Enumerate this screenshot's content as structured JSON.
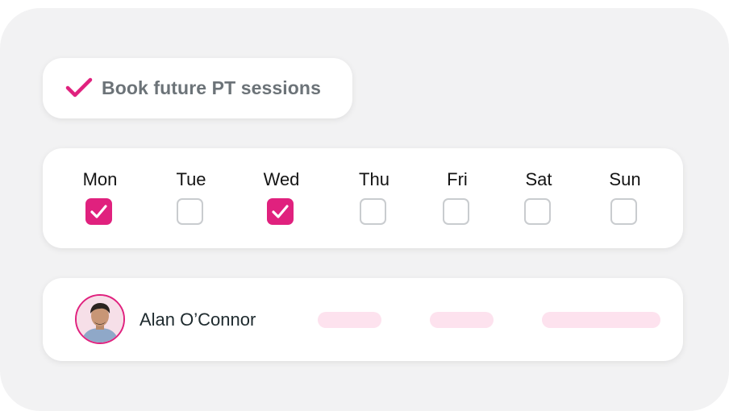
{
  "task": {
    "label": "Book future PT sessions",
    "checked": true
  },
  "days": [
    {
      "label": "Mon",
      "checked": true
    },
    {
      "label": "Tue",
      "checked": false
    },
    {
      "label": "Wed",
      "checked": true
    },
    {
      "label": "Thu",
      "checked": false
    },
    {
      "label": "Fri",
      "checked": false
    },
    {
      "label": "Sat",
      "checked": false
    },
    {
      "label": "Sun",
      "checked": false
    }
  ],
  "person": {
    "name": "Alan O’Connor"
  },
  "colors": {
    "accent": "#e0217e",
    "placeholder": "#fde2ee",
    "background": "#f2f2f3"
  }
}
